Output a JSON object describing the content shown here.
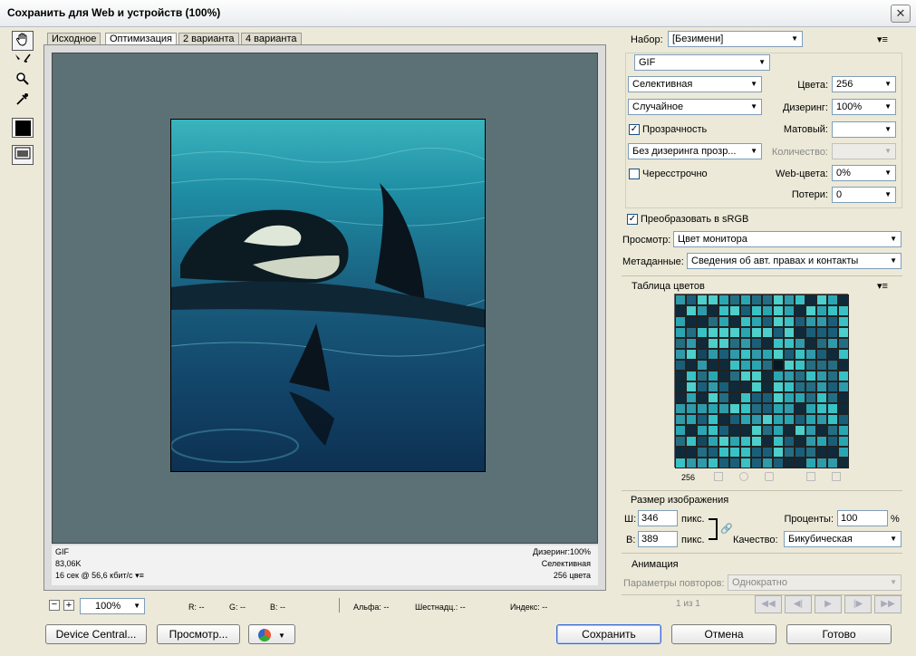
{
  "window": {
    "title": "Сохранить для Web и устройств (100%)",
    "close": "✕"
  },
  "tabs": [
    "Исходное",
    "Оптимизация",
    "2 варианта",
    "4 варианта"
  ],
  "image_info": {
    "format": "GIF",
    "size": "83,06K",
    "time": "16 сек @ 56,6 кбит/с",
    "dither": "Дизеринг:100%",
    "palette": "Селективная",
    "colors": "256 цвета"
  },
  "bottom_bar": {
    "zoom": "100%",
    "r": "R: --",
    "g": "G: --",
    "b": "B: --",
    "alpha": "Альфа: --",
    "hex": "Шестнадц.: --",
    "index": "Индекс: --"
  },
  "settings": {
    "preset_label": "Набор:",
    "preset_value": "[Безимени]",
    "format": "GIF",
    "reduction": "Селективная",
    "colors_label": "Цвета:",
    "colors_value": "256",
    "dither_alg": "Случайное",
    "dither_label": "Дизеринг:",
    "dither_value": "100%",
    "transparency": "Прозрачность",
    "matte_label": "Матовый:",
    "matte_value": "",
    "transp_dither": "Без дизеринга прозр...",
    "amount_label": "Количество:",
    "interlaced": "Чересстрочно",
    "websnap_label": "Web-цвета:",
    "websnap_value": "0%",
    "lossy_label": "Потери:",
    "lossy_value": "0",
    "convert_srgb": "Преобразовать в sRGB",
    "preview_label": "Просмотр:",
    "preview_value": "Цвет монитора",
    "metadata_label": "Метаданные:",
    "metadata_value": "Сведения об авт. правах и контакты",
    "transparency_checked": true,
    "interlaced_checked": false,
    "convert_checked": true
  },
  "color_table": {
    "title": "Таблица цветов",
    "count": "256"
  },
  "image_size": {
    "title": "Размер изображения",
    "w_label": "Ш:",
    "w_value": "346",
    "h_label": "В:",
    "h_value": "389",
    "unit": "пикс.",
    "percent_label": "Проценты:",
    "percent_value": "100",
    "percent_sign": "%",
    "quality_label": "Качество:",
    "quality_value": "Бикубическая"
  },
  "animation": {
    "title": "Анимация",
    "loop_label": "Параметры повторов:",
    "loop_value": "Однократно",
    "frame": "1 из 1"
  },
  "buttons": {
    "device_central": "Device Central...",
    "preview": "Просмотр...",
    "save": "Сохранить",
    "cancel": "Отмена",
    "done": "Готово"
  },
  "colors": {
    "accent": "#3a6ad6",
    "canvas_bg": "#5c7176"
  }
}
